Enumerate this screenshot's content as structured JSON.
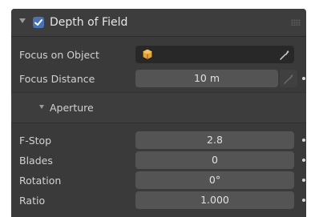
{
  "panel": {
    "title": "Depth of Field",
    "enabled": true
  },
  "focus_object": {
    "label": "Focus on Object",
    "value": ""
  },
  "focus_distance": {
    "label": "Focus Distance",
    "value": "10 m"
  },
  "aperture": {
    "label": "Aperture",
    "fstop": {
      "label": "F-Stop",
      "value": "2.8"
    },
    "blades": {
      "label": "Blades",
      "value": "0"
    },
    "rotation": {
      "label": "Rotation",
      "value": "0°"
    },
    "ratio": {
      "label": "Ratio",
      "value": "1.000"
    }
  },
  "colors": {
    "panel_bg": "#3a3a3a",
    "field_bg": "#545454",
    "object_field_bg": "#282828",
    "checkbox": "#4772b3",
    "object_icon": "#e8a13b"
  },
  "icons": {
    "collapse": "triangle-down-icon",
    "checkbox": "check-icon",
    "object": "object-cube-icon",
    "eyedropper": "eyedropper-icon",
    "grip": "drag-grip-icon",
    "keyframe": "keyframe-dot-icon"
  }
}
